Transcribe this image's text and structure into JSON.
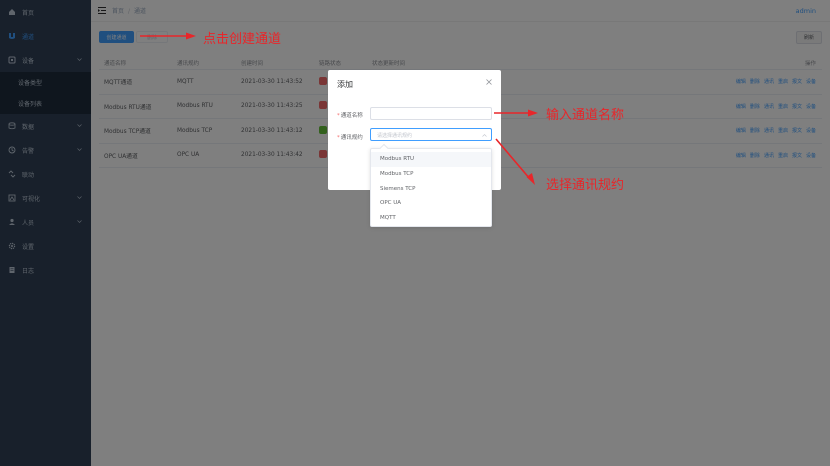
{
  "sidebar": {
    "items": [
      {
        "label": "首页",
        "icon": "home-icon",
        "active": false
      },
      {
        "label": "通道",
        "icon": "channel-icon",
        "active": true
      },
      {
        "label": "设备",
        "icon": "device-icon",
        "active": false,
        "expanded": true,
        "children": [
          {
            "label": "设备类型"
          },
          {
            "label": "设备列表"
          }
        ]
      },
      {
        "label": "数据",
        "icon": "data-icon",
        "active": false,
        "has_arrow": true
      },
      {
        "label": "告警",
        "icon": "alarm-icon",
        "active": false,
        "has_arrow": true
      },
      {
        "label": "联动",
        "icon": "linkage-icon",
        "active": false
      },
      {
        "label": "可视化",
        "icon": "visualization-icon",
        "active": false,
        "has_arrow": true
      },
      {
        "label": "人员",
        "icon": "user-icon",
        "active": false,
        "has_arrow": true
      },
      {
        "label": "设置",
        "icon": "gear-icon",
        "active": false
      },
      {
        "label": "日志",
        "icon": "log-icon",
        "active": false
      }
    ]
  },
  "header": {
    "breadcrumb": [
      "首页",
      "通道"
    ],
    "user": "admin"
  },
  "toolbar": {
    "create_label": "创建通道",
    "delete_label": "删除",
    "refresh_label": "刷新"
  },
  "table": {
    "columns": [
      "通道名称",
      "通讯规约",
      "创建时间",
      "链路状态",
      "状态更新时间",
      "操作"
    ],
    "rows": [
      {
        "name": "MQTT通道",
        "protocol": "MQTT",
        "created": "2021-03-30 11:43:52",
        "status_color": "#f56c6c"
      },
      {
        "name": "Modbus RTU通道",
        "protocol": "Modbus RTU",
        "created": "2021-03-30 11:43:25",
        "status_color": "#f56c6c"
      },
      {
        "name": "Modbus TCP通道",
        "protocol": "Modbus TCP",
        "created": "2021-03-30 11:43:12",
        "status_color": "#67c23a"
      },
      {
        "name": "OPC UA通道",
        "protocol": "OPC UA",
        "created": "2021-03-30 11:43:42",
        "status_color": "#f56c6c"
      }
    ],
    "actions": [
      "编辑",
      "删除",
      "通讯",
      "重启",
      "报文",
      "设备"
    ]
  },
  "dialog": {
    "title": "添加",
    "name_label": "通道名称",
    "protocol_label": "通讯规约",
    "protocol_placeholder": "请选择通讯规约"
  },
  "dropdown": {
    "options": [
      "Modbus RTU",
      "Modbus TCP",
      "Siemens TCP",
      "OPC UA",
      "MQTT"
    ],
    "hovered_index": 0
  },
  "annotations": {
    "create": "点击创建通道",
    "name": "输入通道名称",
    "protocol": "选择通讯规约"
  },
  "colors": {
    "sidebar_bg": "#304156",
    "accent": "#409eff",
    "annotation_red": "#e8262a"
  }
}
